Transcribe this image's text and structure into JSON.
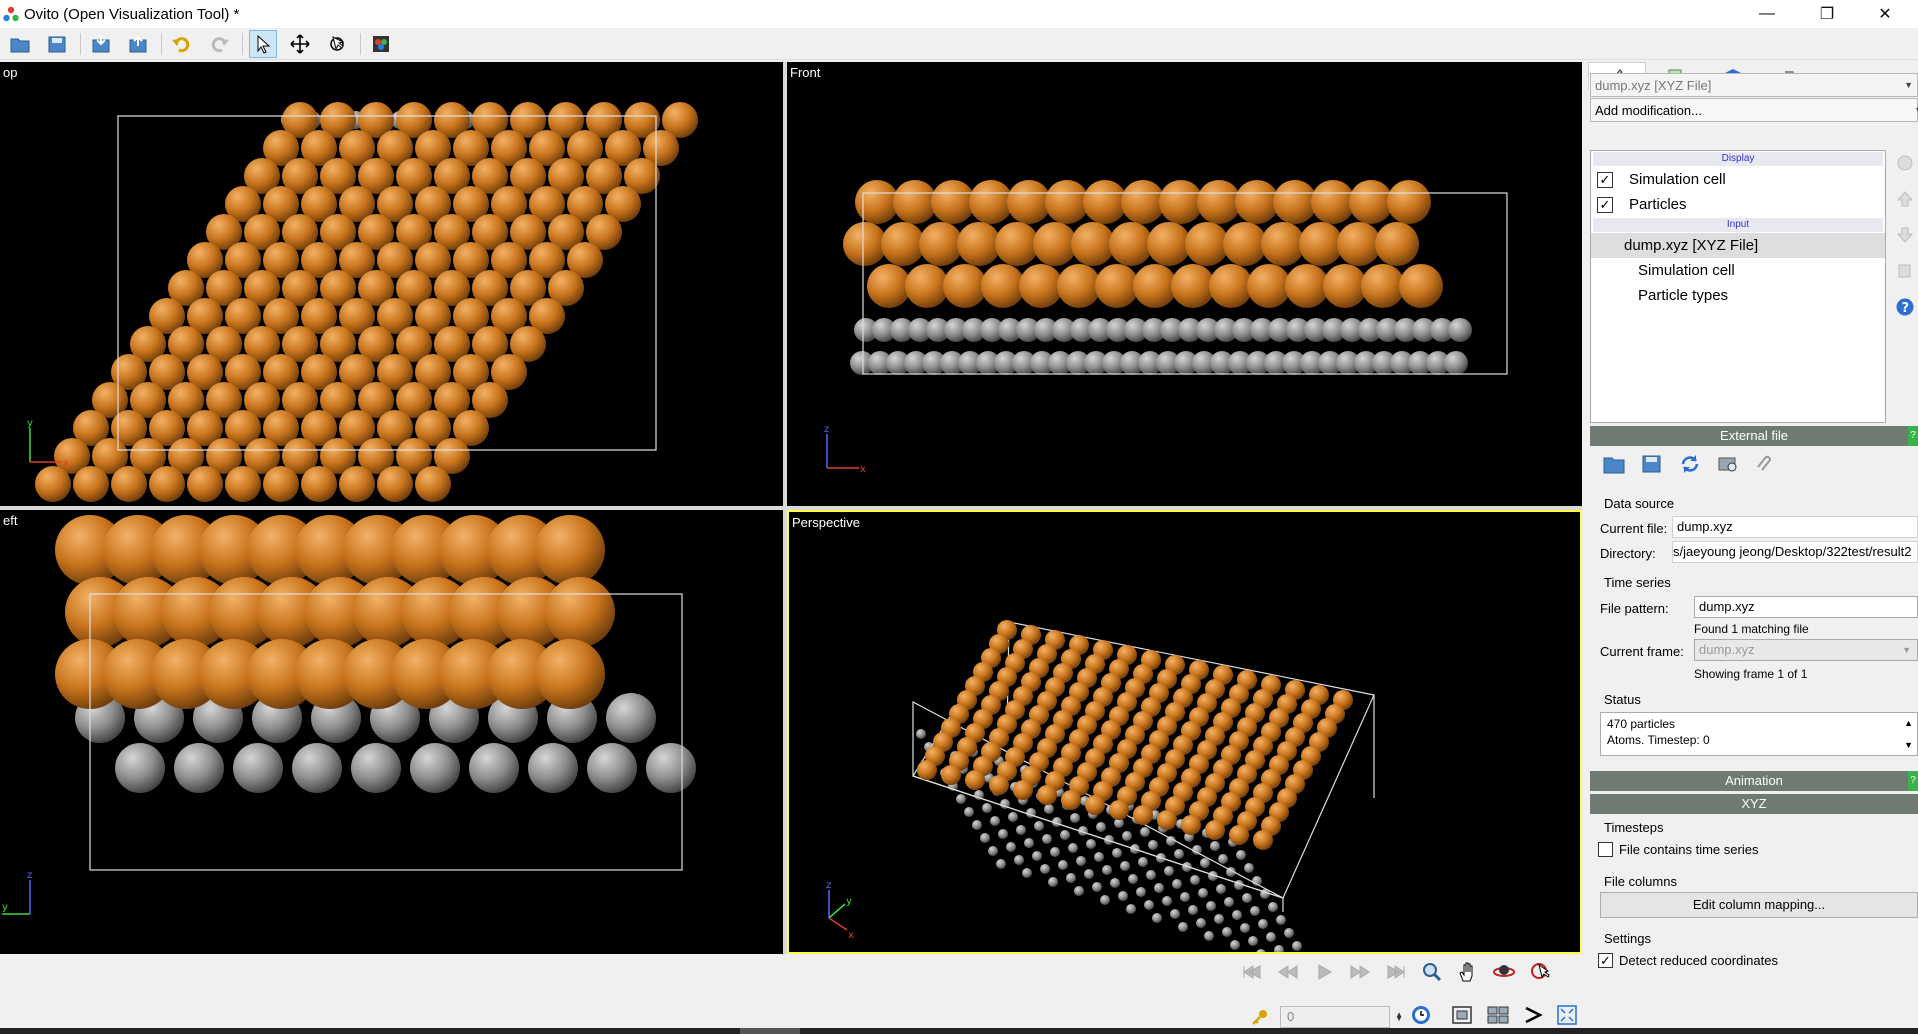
{
  "window": {
    "title": "Ovito (Open Visualization Tool) *",
    "controls": {
      "minimize": "—",
      "maximize": "❐",
      "close": "✕"
    }
  },
  "toolbar": {
    "buttons": [
      "load-file",
      "save-file",
      "import",
      "export",
      "undo",
      "redo",
      "select-mode",
      "move-mode",
      "orbit-pick-mode",
      "render-active-viewport"
    ]
  },
  "viewports": {
    "top": {
      "caption": "op",
      "axes": [
        "y",
        "x"
      ]
    },
    "front": {
      "caption": "Front",
      "axes": [
        "z",
        "x"
      ]
    },
    "left": {
      "caption": "eft",
      "axes": [
        "z",
        "y"
      ]
    },
    "perspective": {
      "caption": "Perspective",
      "axes": [
        "z",
        "y",
        "x"
      ]
    }
  },
  "colors": {
    "particle_orange": "#c8741c",
    "particle_gray": "#8e8e8e",
    "active_border": "#ffff40",
    "rollout_header": "#6f7a73"
  },
  "panel": {
    "source_combo": "dump.xyz [XYZ File]",
    "add_modification": "Add modification...",
    "pipeline": {
      "display_header": "Display",
      "display_items": [
        {
          "label": "Simulation cell",
          "checked": true
        },
        {
          "label": "Particles",
          "checked": true
        }
      ],
      "input_header": "Input",
      "input_item": "dump.xyz [XYZ File]",
      "sub_items": [
        "Simulation cell",
        "Particle types"
      ]
    },
    "external_file": {
      "title": "External file",
      "help": "?",
      "data_source_label": "Data source",
      "current_file_label": "Current file:",
      "current_file": "dump.xyz",
      "directory_label": "Directory:",
      "directory": "s/jaeyoung jeong/Desktop/322test/result2",
      "time_series_label": "Time series",
      "file_pattern_label": "File pattern:",
      "file_pattern": "dump.xyz",
      "found_text": "Found 1 matching file",
      "current_frame_label": "Current frame:",
      "current_frame": "dump.xyz",
      "showing_text": "Showing frame 1 of 1",
      "status_label": "Status",
      "status_line1": "470 particles",
      "status_line2": "Atoms. Timestep: 0"
    },
    "animation": {
      "title": "Animation",
      "help": "?"
    },
    "xyz": {
      "title": "XYZ",
      "timesteps_label": "Timesteps",
      "contains_time_series": "File contains time series",
      "contains_time_series_checked": false,
      "file_columns_label": "File columns",
      "edit_mapping": "Edit column mapping...",
      "settings_label": "Settings",
      "detect_reduced": "Detect reduced coordinates",
      "detect_reduced_checked": true
    }
  },
  "animation_bar": {
    "frame_value": "0"
  }
}
